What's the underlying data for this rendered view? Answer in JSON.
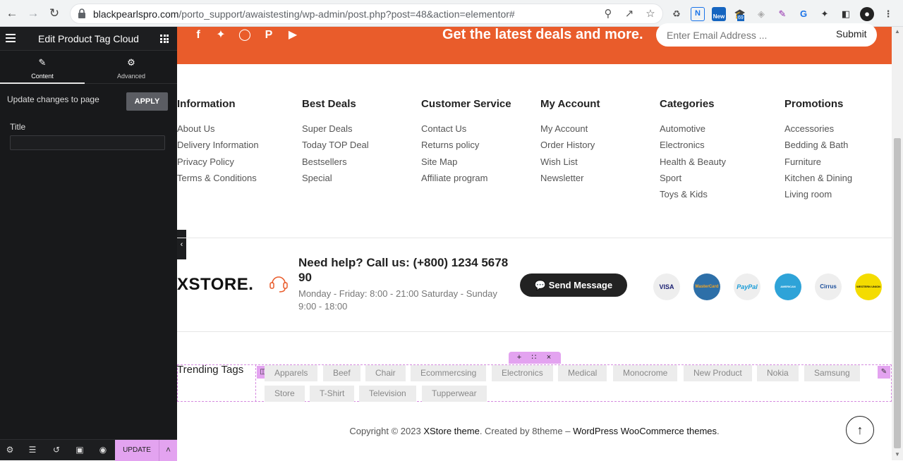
{
  "browser": {
    "url_host": "blackpearlspro.com",
    "url_path": "/porto_support/awaistesting/wp-admin/post.php?post=48&action=elementor#",
    "ext_badges": {
      "new": "New",
      "count": "69"
    }
  },
  "panel": {
    "title": "Edit Product Tag Cloud",
    "tabs": [
      {
        "label": "Content",
        "icon": "pencil-icon"
      },
      {
        "label": "Advanced",
        "icon": "gear-icon"
      }
    ],
    "apply_text": "Update changes to page",
    "apply_label": "APPLY",
    "title_label": "Title",
    "title_value": "",
    "update_label": "UPDATE"
  },
  "banner": {
    "headline": "Get the latest deals and more.",
    "email_placeholder": "Enter Email Address ...",
    "submit_label": "Submit",
    "social": [
      "facebook-icon",
      "twitter-icon",
      "instagram-icon",
      "pinterest-icon",
      "youtube-icon"
    ]
  },
  "footer_columns": [
    {
      "heading": "Information",
      "links": [
        "About Us",
        "Delivery Information",
        "Privacy Policy",
        "Terms & Conditions"
      ]
    },
    {
      "heading": "Best Deals",
      "links": [
        "Super Deals",
        "Today TOP Deal",
        "Bestsellers",
        "Special"
      ]
    },
    {
      "heading": "Customer Service",
      "links": [
        "Contact Us",
        "Returns policy",
        "Site Map",
        "Affiliate program"
      ]
    },
    {
      "heading": "My Account",
      "links": [
        "My Account",
        "Order History",
        "Wish List",
        "Newsletter"
      ]
    },
    {
      "heading": "Categories",
      "links": [
        "Automotive",
        "Electronics",
        "Health & Beauty",
        "Sport",
        "Toys & Kids"
      ]
    },
    {
      "heading": "Promotions",
      "links": [
        "Accessories",
        "Bedding & Bath",
        "Furniture",
        "Kitchen & Dining",
        "Living room"
      ]
    }
  ],
  "contact": {
    "logo": "XSTORE.",
    "help": "Need help? Call us: (+800) 1234 5678 90",
    "hours": "Monday - Friday: 8:00 - 21:00 Saturday - Sunday 9:00 - 18:00",
    "send_label": "Send Message",
    "payments": [
      "VISA",
      "MasterCard",
      "PayPal",
      "AMERICAN EXPRESS",
      "Cirrus",
      "WESTERN UNION"
    ]
  },
  "trending": {
    "heading": "Trending Tags",
    "tags": [
      "Apparels",
      "Beef",
      "Chair",
      "Ecommercsing",
      "Electronics",
      "Medical",
      "Monocrome",
      "New Product",
      "Nokia",
      "Samsung",
      "Store",
      "T-Shirt",
      "Television",
      "Tupperwear"
    ]
  },
  "copyright": {
    "pre": "Copyright © 2023 ",
    "brand": "XStore theme",
    "mid": ". Created by 8theme – ",
    "link": "WordPress WooCommerce themes",
    "post": "."
  },
  "colors": {
    "accent": "#e95c2b",
    "editor": "#e3a3f0",
    "panel": "#18191b"
  }
}
